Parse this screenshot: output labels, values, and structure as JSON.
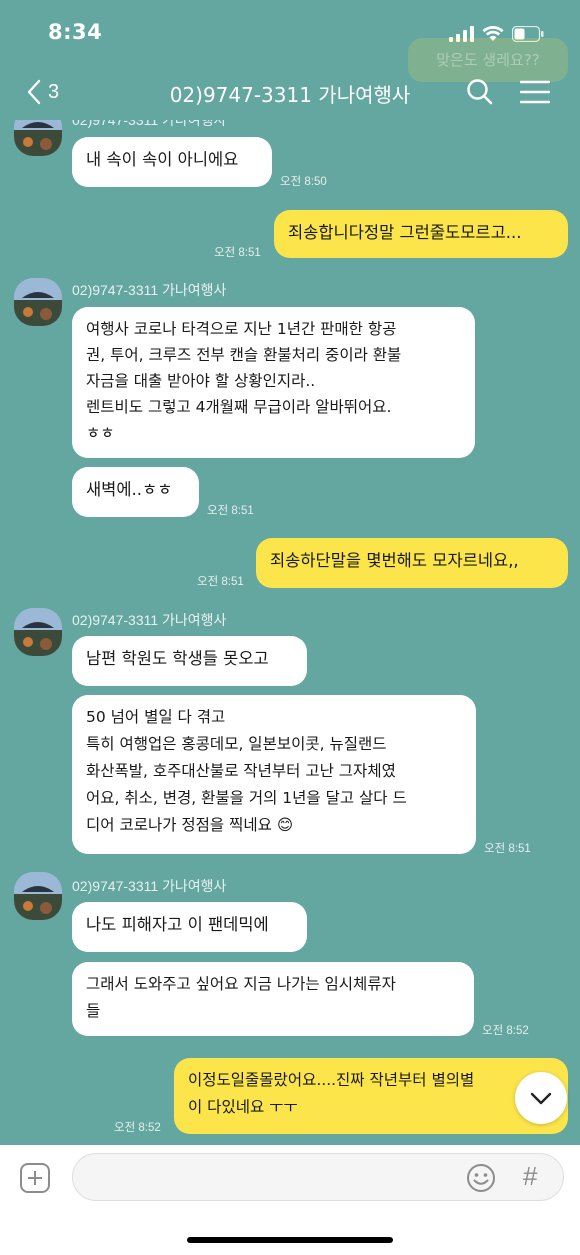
{
  "status": {
    "time": "8:34"
  },
  "nav": {
    "back_count": "3",
    "title": "02)9747-3311 가나여행사"
  },
  "ghost_text": "맞은도 생레요??",
  "messages": {
    "m1": "내 속이 속이 아니에요",
    "m1_time": "오전 8:50",
    "m2": "죄송합니다정말 그런줄도모르고...",
    "m2_time": "오전 8:51",
    "sender1": "02)9747-3311 가나여행사",
    "m3": "여행사 코로나 타격으로 지난 1년간 판매한 항공\n권, 투어, 크루즈 전부 캔슬 환불처리 중이라 환불\n자금을 대출 받아야 할 상황인지라..\n렌트비도 그렇고 4개월째 무급이라 알바뛰어요.\nㅎㅎ",
    "m4": "새벽에..ㅎㅎ",
    "m4_time": "오전 8:51",
    "m5": "죄송하단말을 몇번해도 모자르네요,,",
    "m5_time": "오전 8:51",
    "sender2": "02)9747-3311 가나여행사",
    "m6": "남편 학원도 학생들 못오고",
    "m7": "50 넘어 별일 다 겪고\n특히 여행업은 홍콩데모, 일본보이콧, 뉴질랜드\n화산폭발, 호주대산불로 작년부터 고난 그자체였\n어요, 취소, 변경, 환불을 거의 1년을 달고 살다 드\n디어 코로나가 정점을 찍네요 😊",
    "m7_time": "오전 8:51",
    "sender3": "02)9747-3311 가나여행사",
    "m8": "나도 피해자고 이 팬데믹에",
    "m9": "그래서 도와주고 싶어요 지금 나가는 임시체류자\n들",
    "m9_time": "오전 8:52",
    "m10": "이정도일줄몰랐어요....진짜 작년부터 별의별\n이 다있네요 ㅜㅜ",
    "m10_time": "오전 8:52"
  },
  "top_partial_sender": "02)9747-3311 가나여행사",
  "input": {
    "placeholder": "",
    "hash": "#"
  },
  "colors": {
    "background": "#64a6a0",
    "my_bubble": "#fbe54a",
    "their_bubble": "#ffffff"
  }
}
